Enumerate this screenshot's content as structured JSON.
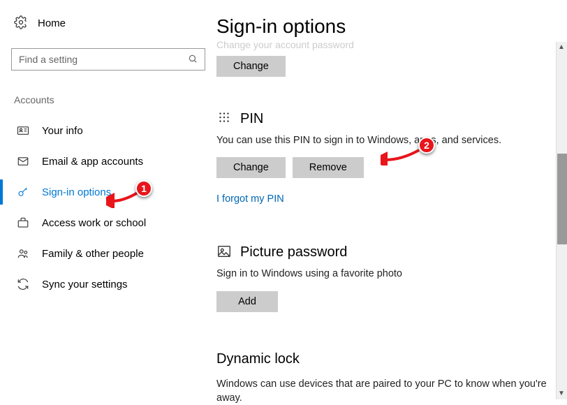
{
  "sidebar": {
    "home_label": "Home",
    "search_placeholder": "Find a setting",
    "category": "Accounts",
    "items": [
      {
        "label": "Your info"
      },
      {
        "label": "Email & app accounts"
      },
      {
        "label": "Sign-in options"
      },
      {
        "label": "Access work or school"
      },
      {
        "label": "Family & other people"
      },
      {
        "label": "Sync your settings"
      }
    ]
  },
  "main": {
    "title": "Sign-in options",
    "password": {
      "truncated_desc": "Change your account password",
      "change_label": "Change"
    },
    "pin": {
      "title": "PIN",
      "desc": "You can use this PIN to sign in to Windows, apps, and services.",
      "change_label": "Change",
      "remove_label": "Remove",
      "forgot_link": "I forgot my PIN"
    },
    "picture": {
      "title": "Picture password",
      "desc": "Sign in to Windows using a favorite photo",
      "add_label": "Add"
    },
    "dynamic": {
      "title": "Dynamic lock",
      "desc": "Windows can use devices that are paired to your PC to know when you're away."
    }
  },
  "annotations": {
    "badge1": "1",
    "badge2": "2"
  }
}
